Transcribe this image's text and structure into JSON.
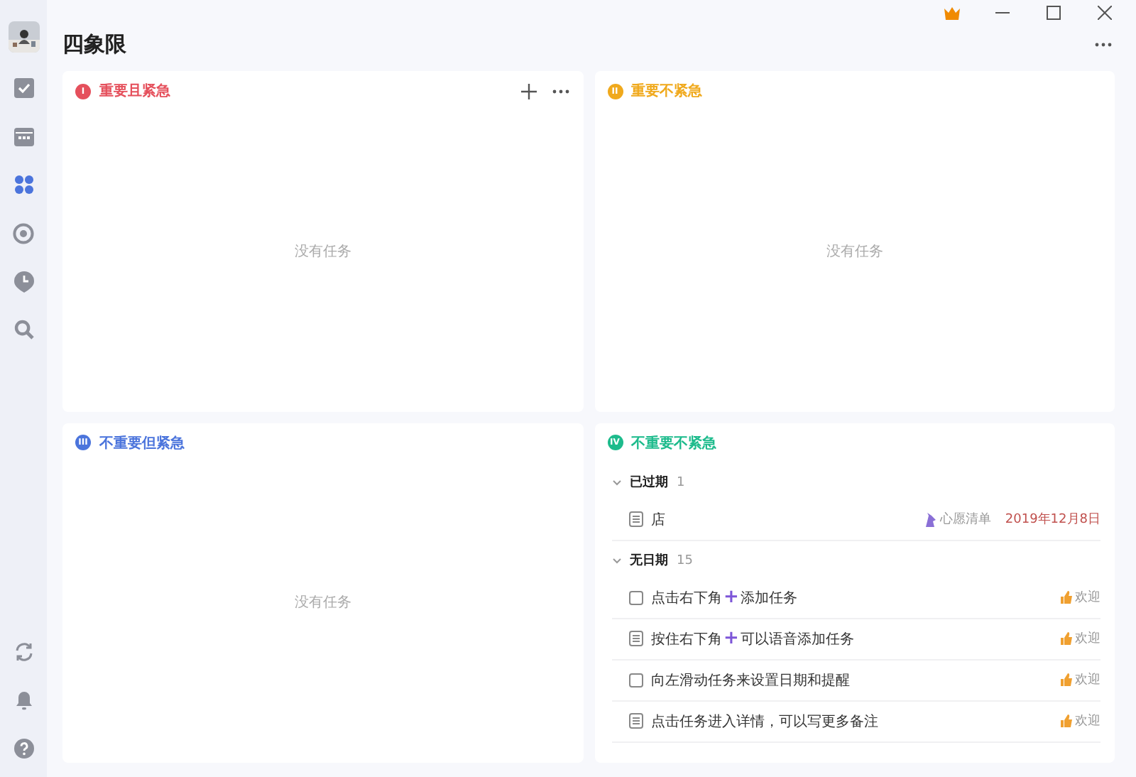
{
  "window": {
    "title": "四象限"
  },
  "sidebar": {
    "top": [
      {
        "kind": "avatar",
        "selected": false
      },
      {
        "kind": "check",
        "selected": false
      },
      {
        "kind": "calendar",
        "selected": false
      },
      {
        "kind": "quadrants",
        "selected": true
      },
      {
        "kind": "focus",
        "selected": false
      },
      {
        "kind": "pin",
        "selected": false
      },
      {
        "kind": "search",
        "selected": false
      }
    ],
    "bottom": [
      {
        "kind": "sync",
        "selected": false
      },
      {
        "kind": "bell",
        "selected": false
      },
      {
        "kind": "help",
        "selected": false
      }
    ]
  },
  "quadrants": [
    {
      "badge": "I",
      "title": "重要且紧急",
      "color": "#e5505c",
      "actions": true,
      "empty": "没有任务"
    },
    {
      "badge": "II",
      "title": "重要不紧急",
      "color": "#f0a91c",
      "actions": false,
      "empty": "没有任务"
    },
    {
      "badge": "III",
      "title": "不重要但紧急",
      "color": "#4b74dc",
      "actions": false,
      "empty": "没有任务"
    },
    {
      "badge": "IV",
      "title": "不重要不紧急",
      "color": "#1dbb8c",
      "actions": false,
      "groups": [
        {
          "title": "已过期",
          "count": "1",
          "expanded": true,
          "tasks": [
            {
              "kind": "note",
              "parts": [
                {
                  "text": "店"
                }
              ],
              "list": "心愿清单",
              "date": "2019年12月8日"
            }
          ]
        },
        {
          "title": "无日期",
          "count": "15",
          "expanded": true,
          "tasks": [
            {
              "kind": "checkbox",
              "checked": false,
              "parts": [
                {
                  "text": "点击右下角"
                },
                {
                  "glyph": "+"
                },
                {
                  "text": "添加任务"
                }
              ],
              "tag": "欢迎"
            },
            {
              "kind": "note",
              "parts": [
                {
                  "text": "按住右下角"
                },
                {
                  "glyph": "+"
                },
                {
                  "text": "可以语音添加任务"
                }
              ],
              "tag": "欢迎"
            },
            {
              "kind": "checkbox",
              "checked": false,
              "parts": [
                {
                  "text": "向左滑动任务来设置日期和提醒"
                }
              ],
              "tag": "欢迎"
            },
            {
              "kind": "note",
              "parts": [
                {
                  "text": "点击任务进入详情，可以写更多备注"
                }
              ],
              "tag": "欢迎"
            }
          ]
        }
      ]
    }
  ]
}
